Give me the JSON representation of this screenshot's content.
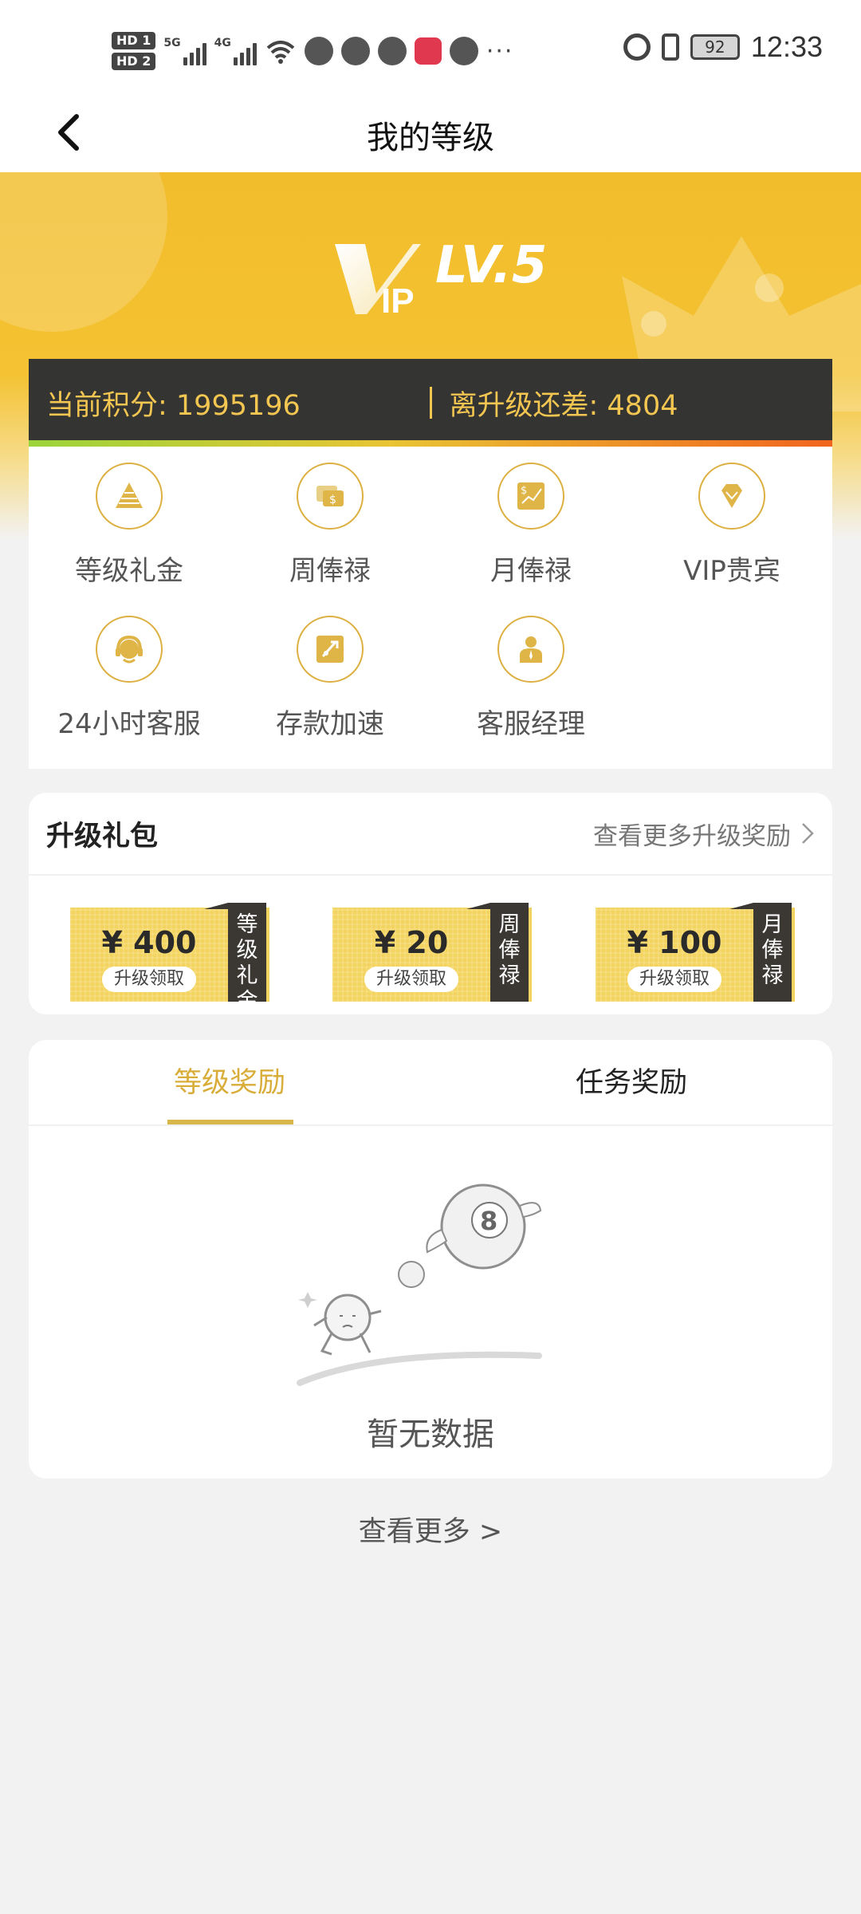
{
  "status_bar": {
    "hd_labels": [
      "HD 1",
      "HD 2"
    ],
    "network_labels": [
      "5G",
      "4G"
    ],
    "battery": "92",
    "time": "12:33",
    "icons": [
      "wechat-icon",
      "browser-icon",
      "chat-icon",
      "reader-icon",
      "message-icon",
      "alarm-icon",
      "vibrate-icon",
      "battery-icon"
    ]
  },
  "nav": {
    "title": "我的等级",
    "back_icon": "chevron-left-icon"
  },
  "hero": {
    "logo_text": "VIP",
    "level": "LV.5"
  },
  "points": {
    "current": "当前积分: 1995196",
    "remaining": "离升级还差: 4804"
  },
  "benefits": [
    {
      "label": "等级礼金",
      "icon": "pyramid-icon"
    },
    {
      "label": "周俸禄",
      "icon": "money-card-icon"
    },
    {
      "label": "月俸禄",
      "icon": "chart-dollar-icon"
    },
    {
      "label": "VIP贵宾",
      "icon": "diamond-icon"
    },
    {
      "label": "24小时客服",
      "icon": "headset-icon"
    },
    {
      "label": "存款加速",
      "icon": "rocket-icon"
    },
    {
      "label": "客服经理",
      "icon": "manager-icon"
    }
  ],
  "gift": {
    "title": "升级礼包",
    "more": "查看更多升级奖励",
    "tickets": [
      {
        "amount": "¥ 400",
        "claim": "升级领取",
        "tag": "等级礼金"
      },
      {
        "amount": "¥ 20",
        "claim": "升级领取",
        "tag": "周俸禄"
      },
      {
        "amount": "¥ 100",
        "claim": "升级领取",
        "tag": "月俸禄"
      }
    ]
  },
  "tabs": {
    "items": [
      "等级奖励",
      "任务奖励"
    ],
    "active": 0,
    "empty_text": "暂无数据"
  },
  "footer": {
    "view_more": "查看更多 >"
  },
  "colors": {
    "gold": "#f2bd2c",
    "dark_bar": "#343433",
    "accent_text": "#f3c651",
    "tab_active": "#d9ad3a"
  }
}
